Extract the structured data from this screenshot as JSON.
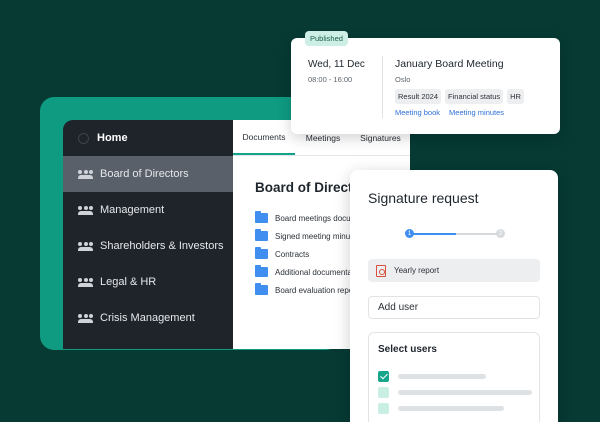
{
  "sidebar": {
    "home_label": "Home",
    "items": [
      {
        "label": "Board of Directors",
        "active": true
      },
      {
        "label": "Management",
        "active": false
      },
      {
        "label": "Shareholders & Investors",
        "active": false
      },
      {
        "label": "Legal & HR",
        "active": false
      },
      {
        "label": "Crisis Management",
        "active": false
      }
    ]
  },
  "docs": {
    "tabs": [
      {
        "label": "Documents",
        "active": true
      },
      {
        "label": "Meetings",
        "active": false
      },
      {
        "label": "Signatures",
        "active": false
      }
    ],
    "title": "Board of Directors",
    "folders": [
      "Board meetings documents",
      "Signed meeting minutes",
      "Contracts",
      "Additional documentation",
      "Board evaluation reports"
    ]
  },
  "meeting": {
    "badge": "Published",
    "date": "Wed, 11 Dec",
    "time": "08:00 - 16:00",
    "title": "January Board Meeting",
    "location": "Oslo",
    "tags": [
      "Result 2024",
      "Financial status",
      "HR"
    ],
    "links": [
      "Meeting book",
      "Meeting minutes"
    ]
  },
  "signature": {
    "title": "Signature request",
    "steps": [
      "1",
      "2"
    ],
    "current_step": 1,
    "file_label": "Yearly report",
    "add_user_placeholder": "Add user",
    "select_title": "Select users",
    "users": [
      {
        "checked": true
      },
      {
        "checked": false
      },
      {
        "checked": false
      }
    ]
  },
  "colors": {
    "background": "#063a33",
    "accent": "#0f9a82",
    "sidebar": "#1f242b",
    "sidebar_active": "#59606a",
    "link": "#2f6fd6",
    "folder": "#3f8ef0",
    "stepper_active": "#3f8ef0"
  }
}
